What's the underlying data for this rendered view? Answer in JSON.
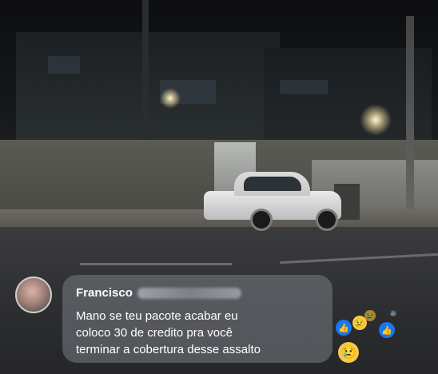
{
  "comment": {
    "author_name": "Francisco",
    "lines": [
      "Mano se teu pacote acabar eu",
      "coloco 30 de credito pra você",
      "terminar a cobertura desse assalto"
    ]
  },
  "reactions": [
    {
      "icon": "like-icon",
      "glyph": "👍"
    },
    {
      "icon": "sad-icon",
      "glyph": "😢"
    },
    {
      "icon": "like-icon",
      "glyph": "👍"
    },
    {
      "icon": "sad-icon",
      "glyph": "😢"
    },
    {
      "icon": "like-icon",
      "glyph": "👍"
    },
    {
      "icon": "sad-icon",
      "glyph": "😢"
    }
  ],
  "colors": {
    "like": "#1877f2",
    "sad": "#f7c948",
    "comment_bubble": "rgba(120,124,132,0.55)"
  }
}
